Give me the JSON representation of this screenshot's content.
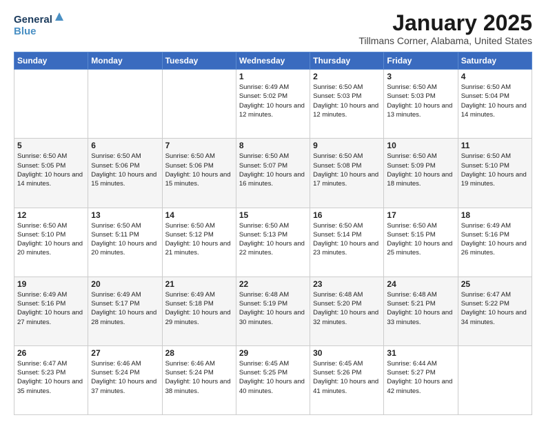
{
  "logo": {
    "line1": "General",
    "line2": "Blue"
  },
  "title": "January 2025",
  "location": "Tillmans Corner, Alabama, United States",
  "weekdays": [
    "Sunday",
    "Monday",
    "Tuesday",
    "Wednesday",
    "Thursday",
    "Friday",
    "Saturday"
  ],
  "weeks": [
    [
      {
        "day": "",
        "sunrise": "",
        "sunset": "",
        "daylight": ""
      },
      {
        "day": "",
        "sunrise": "",
        "sunset": "",
        "daylight": ""
      },
      {
        "day": "",
        "sunrise": "",
        "sunset": "",
        "daylight": ""
      },
      {
        "day": "1",
        "sunrise": "Sunrise: 6:49 AM",
        "sunset": "Sunset: 5:02 PM",
        "daylight": "Daylight: 10 hours and 12 minutes."
      },
      {
        "day": "2",
        "sunrise": "Sunrise: 6:50 AM",
        "sunset": "Sunset: 5:03 PM",
        "daylight": "Daylight: 10 hours and 12 minutes."
      },
      {
        "day": "3",
        "sunrise": "Sunrise: 6:50 AM",
        "sunset": "Sunset: 5:03 PM",
        "daylight": "Daylight: 10 hours and 13 minutes."
      },
      {
        "day": "4",
        "sunrise": "Sunrise: 6:50 AM",
        "sunset": "Sunset: 5:04 PM",
        "daylight": "Daylight: 10 hours and 14 minutes."
      }
    ],
    [
      {
        "day": "5",
        "sunrise": "Sunrise: 6:50 AM",
        "sunset": "Sunset: 5:05 PM",
        "daylight": "Daylight: 10 hours and 14 minutes."
      },
      {
        "day": "6",
        "sunrise": "Sunrise: 6:50 AM",
        "sunset": "Sunset: 5:06 PM",
        "daylight": "Daylight: 10 hours and 15 minutes."
      },
      {
        "day": "7",
        "sunrise": "Sunrise: 6:50 AM",
        "sunset": "Sunset: 5:06 PM",
        "daylight": "Daylight: 10 hours and 15 minutes."
      },
      {
        "day": "8",
        "sunrise": "Sunrise: 6:50 AM",
        "sunset": "Sunset: 5:07 PM",
        "daylight": "Daylight: 10 hours and 16 minutes."
      },
      {
        "day": "9",
        "sunrise": "Sunrise: 6:50 AM",
        "sunset": "Sunset: 5:08 PM",
        "daylight": "Daylight: 10 hours and 17 minutes."
      },
      {
        "day": "10",
        "sunrise": "Sunrise: 6:50 AM",
        "sunset": "Sunset: 5:09 PM",
        "daylight": "Daylight: 10 hours and 18 minutes."
      },
      {
        "day": "11",
        "sunrise": "Sunrise: 6:50 AM",
        "sunset": "Sunset: 5:10 PM",
        "daylight": "Daylight: 10 hours and 19 minutes."
      }
    ],
    [
      {
        "day": "12",
        "sunrise": "Sunrise: 6:50 AM",
        "sunset": "Sunset: 5:10 PM",
        "daylight": "Daylight: 10 hours and 20 minutes."
      },
      {
        "day": "13",
        "sunrise": "Sunrise: 6:50 AM",
        "sunset": "Sunset: 5:11 PM",
        "daylight": "Daylight: 10 hours and 20 minutes."
      },
      {
        "day": "14",
        "sunrise": "Sunrise: 6:50 AM",
        "sunset": "Sunset: 5:12 PM",
        "daylight": "Daylight: 10 hours and 21 minutes."
      },
      {
        "day": "15",
        "sunrise": "Sunrise: 6:50 AM",
        "sunset": "Sunset: 5:13 PM",
        "daylight": "Daylight: 10 hours and 22 minutes."
      },
      {
        "day": "16",
        "sunrise": "Sunrise: 6:50 AM",
        "sunset": "Sunset: 5:14 PM",
        "daylight": "Daylight: 10 hours and 23 minutes."
      },
      {
        "day": "17",
        "sunrise": "Sunrise: 6:50 AM",
        "sunset": "Sunset: 5:15 PM",
        "daylight": "Daylight: 10 hours and 25 minutes."
      },
      {
        "day": "18",
        "sunrise": "Sunrise: 6:49 AM",
        "sunset": "Sunset: 5:16 PM",
        "daylight": "Daylight: 10 hours and 26 minutes."
      }
    ],
    [
      {
        "day": "19",
        "sunrise": "Sunrise: 6:49 AM",
        "sunset": "Sunset: 5:16 PM",
        "daylight": "Daylight: 10 hours and 27 minutes."
      },
      {
        "day": "20",
        "sunrise": "Sunrise: 6:49 AM",
        "sunset": "Sunset: 5:17 PM",
        "daylight": "Daylight: 10 hours and 28 minutes."
      },
      {
        "day": "21",
        "sunrise": "Sunrise: 6:49 AM",
        "sunset": "Sunset: 5:18 PM",
        "daylight": "Daylight: 10 hours and 29 minutes."
      },
      {
        "day": "22",
        "sunrise": "Sunrise: 6:48 AM",
        "sunset": "Sunset: 5:19 PM",
        "daylight": "Daylight: 10 hours and 30 minutes."
      },
      {
        "day": "23",
        "sunrise": "Sunrise: 6:48 AM",
        "sunset": "Sunset: 5:20 PM",
        "daylight": "Daylight: 10 hours and 32 minutes."
      },
      {
        "day": "24",
        "sunrise": "Sunrise: 6:48 AM",
        "sunset": "Sunset: 5:21 PM",
        "daylight": "Daylight: 10 hours and 33 minutes."
      },
      {
        "day": "25",
        "sunrise": "Sunrise: 6:47 AM",
        "sunset": "Sunset: 5:22 PM",
        "daylight": "Daylight: 10 hours and 34 minutes."
      }
    ],
    [
      {
        "day": "26",
        "sunrise": "Sunrise: 6:47 AM",
        "sunset": "Sunset: 5:23 PM",
        "daylight": "Daylight: 10 hours and 35 minutes."
      },
      {
        "day": "27",
        "sunrise": "Sunrise: 6:46 AM",
        "sunset": "Sunset: 5:24 PM",
        "daylight": "Daylight: 10 hours and 37 minutes."
      },
      {
        "day": "28",
        "sunrise": "Sunrise: 6:46 AM",
        "sunset": "Sunset: 5:24 PM",
        "daylight": "Daylight: 10 hours and 38 minutes."
      },
      {
        "day": "29",
        "sunrise": "Sunrise: 6:45 AM",
        "sunset": "Sunset: 5:25 PM",
        "daylight": "Daylight: 10 hours and 40 minutes."
      },
      {
        "day": "30",
        "sunrise": "Sunrise: 6:45 AM",
        "sunset": "Sunset: 5:26 PM",
        "daylight": "Daylight: 10 hours and 41 minutes."
      },
      {
        "day": "31",
        "sunrise": "Sunrise: 6:44 AM",
        "sunset": "Sunset: 5:27 PM",
        "daylight": "Daylight: 10 hours and 42 minutes."
      },
      {
        "day": "",
        "sunrise": "",
        "sunset": "",
        "daylight": ""
      }
    ]
  ]
}
